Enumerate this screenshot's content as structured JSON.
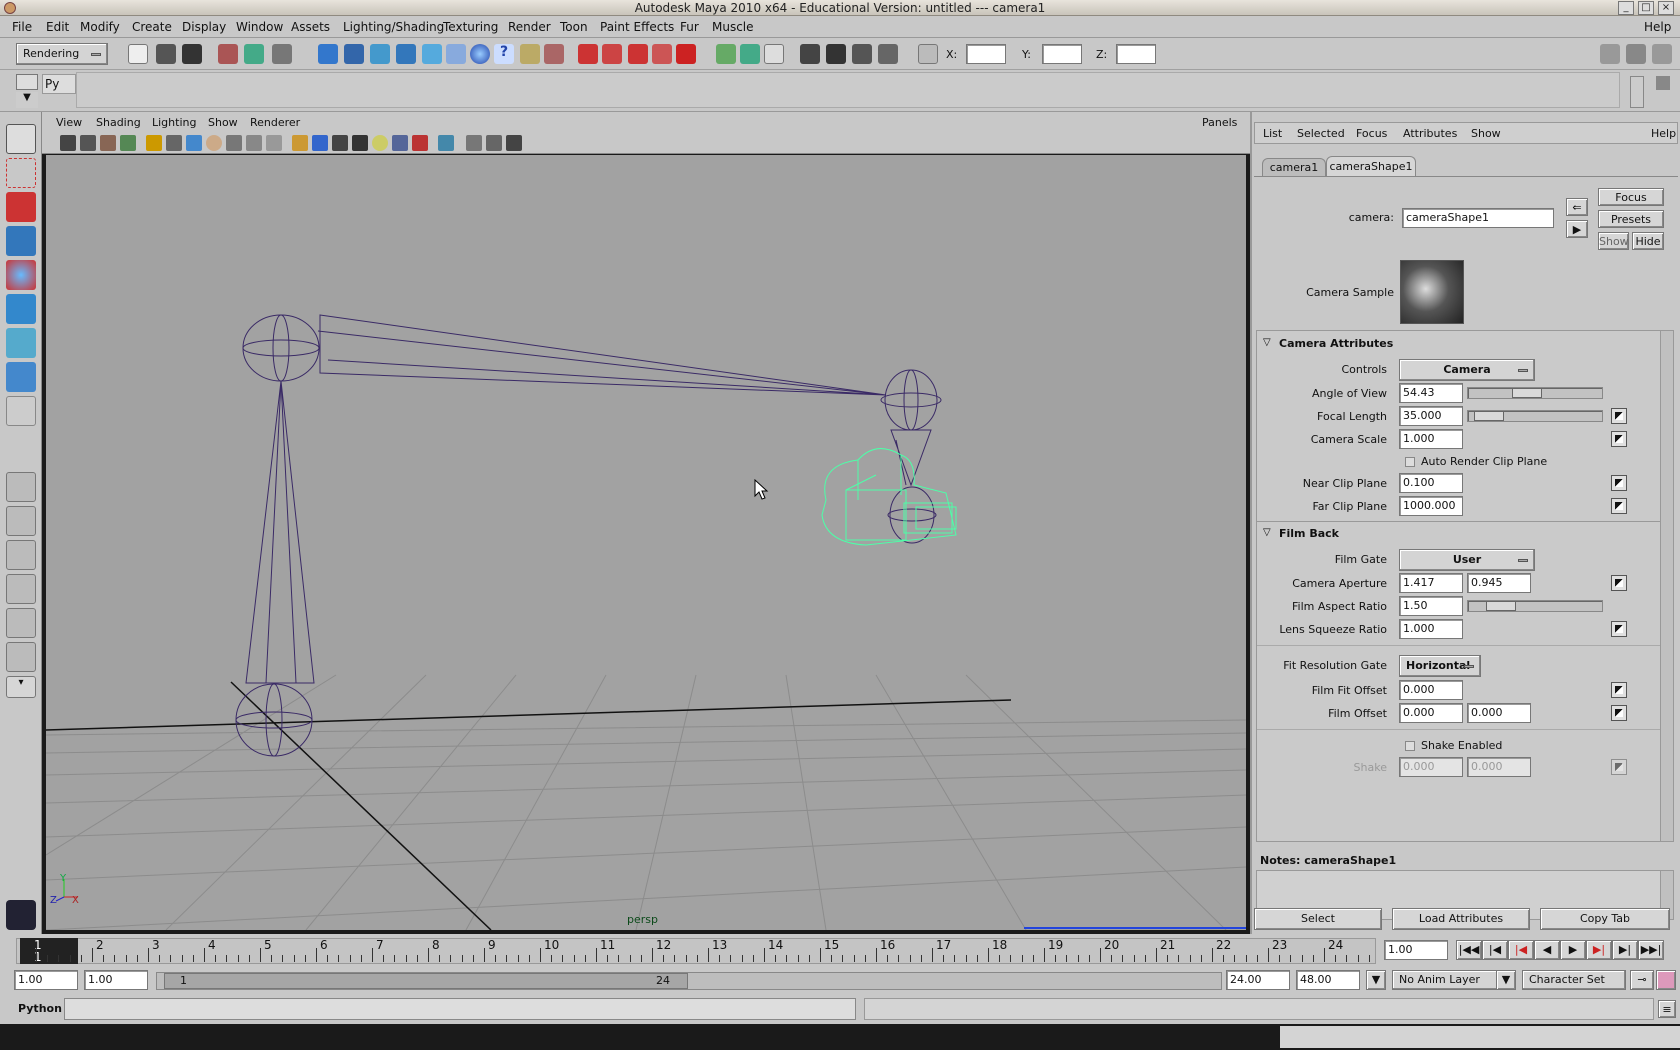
{
  "window": {
    "title": "Autodesk Maya 2010 x64 - Educational Version: untitled    ---    camera1"
  },
  "menu": {
    "items": [
      "File",
      "Edit",
      "Modify",
      "Create",
      "Display",
      "Window",
      "Assets",
      "Lighting/Shading",
      "Texturing",
      "Render",
      "Toon",
      "Paint Effects",
      "Fur",
      "Muscle"
    ],
    "help": "Help"
  },
  "toolbar": {
    "menuset": "Rendering",
    "x_label": "X:",
    "y_label": "Y:",
    "z_label": "Z:"
  },
  "shelf": {
    "py_label": "Py"
  },
  "viewport": {
    "menus": [
      "View",
      "Shading",
      "Lighting",
      "Show",
      "Renderer"
    ],
    "panels": "Panels",
    "camera_label": "persp",
    "axis_y": "Y",
    "axis_z": "Z",
    "axis_x": "X"
  },
  "ae": {
    "menus": [
      "List",
      "Selected",
      "Focus",
      "Attributes",
      "Show"
    ],
    "help": "Help",
    "tabs": [
      "camera1",
      "cameraShape1"
    ],
    "camera_label": "camera:",
    "camera_value": "cameraShape1",
    "focus_btn": "Focus",
    "presets_btn": "Presets",
    "show_btn": "Show",
    "hide_btn": "Hide",
    "camera_sample": "Camera Sample",
    "sections": {
      "camera_attributes": "Camera Attributes",
      "film_back": "Film Back"
    },
    "controls": {
      "label": "Controls",
      "value": "Camera"
    },
    "angle_of_view": {
      "label": "Angle of View",
      "value": "54.43",
      "slider_fraction": 0.4
    },
    "focal_length": {
      "label": "Focal Length",
      "value": "35.000",
      "slider_fraction": 0.1
    },
    "camera_scale": {
      "label": "Camera Scale",
      "value": "1.000"
    },
    "auto_render_clip": "Auto Render Clip Plane",
    "near_clip": {
      "label": "Near Clip Plane",
      "value": "0.100"
    },
    "far_clip": {
      "label": "Far Clip Plane",
      "value": "1000.000"
    },
    "film_gate": {
      "label": "Film Gate",
      "value": "User"
    },
    "camera_aperture": {
      "label": "Camera Aperture",
      "value1": "1.417",
      "value2": "0.945"
    },
    "film_aspect": {
      "label": "Film Aspect Ratio",
      "value": "1.50",
      "slider_fraction": 0.2
    },
    "lens_squeeze": {
      "label": "Lens Squeeze Ratio",
      "value": "1.000"
    },
    "fit_res_gate": {
      "label": "Fit Resolution Gate",
      "value": "Horizontal"
    },
    "film_fit_offset": {
      "label": "Film Fit Offset",
      "value": "0.000"
    },
    "film_offset": {
      "label": "Film Offset",
      "value1": "0.000",
      "value2": "0.000"
    },
    "shake_enabled": "Shake Enabled",
    "shake": {
      "label": "Shake",
      "value1": "0.000",
      "value2": "0.000"
    },
    "notes_label": "Notes:  cameraShape1",
    "select_btn": "Select",
    "load_btn": "Load Attributes",
    "copy_btn": "Copy Tab"
  },
  "timeline": {
    "frames": [
      "1",
      "2",
      "3",
      "4",
      "5",
      "6",
      "7",
      "8",
      "9",
      "10",
      "11",
      "12",
      "13",
      "14",
      "15",
      "16",
      "17",
      "18",
      "19",
      "20",
      "21",
      "22",
      "23",
      "24"
    ],
    "current_frame": "1",
    "current_time": "1.00"
  },
  "range": {
    "start": "1.00",
    "playback_start": "1.00",
    "slider_start": "1",
    "slider_end": "24",
    "playback_end": "24.00",
    "end": "48.00",
    "anim_layer": "No Anim Layer",
    "char_set": "Character Set"
  },
  "cmd": {
    "lang": "Python"
  }
}
